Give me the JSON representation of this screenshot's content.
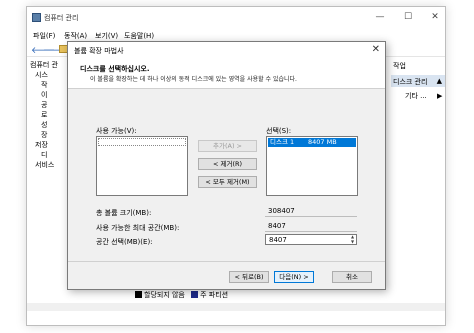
{
  "window": {
    "title": "컴퓨터 관리",
    "controls": {
      "minimize": "—",
      "maximize": "☐",
      "close": "✕"
    }
  },
  "menu": [
    "파일(F)",
    "동작(A)",
    "보기(V)",
    "도움말(H)"
  ],
  "toolbar": {
    "back_icon": "🡐",
    "forward_icon": "🡒"
  },
  "tree": {
    "root": "컴퓨터 관",
    "items": [
      "시스",
      "작",
      "이",
      "공",
      "로",
      "성",
      "장",
      "저장",
      "디",
      "서비스"
    ]
  },
  "actions": {
    "header": "작업",
    "selected": "디스크 관리",
    "selected_arrow": "▲",
    "other": "기타 ...",
    "other_arrow": "▶"
  },
  "legend": {
    "unallocated": "할당되지 않음",
    "primary": "주 파티션"
  },
  "dialog": {
    "title": "볼륨 확장 마법사",
    "close": "✕",
    "heading": "디스크를 선택하십시오.",
    "subheading": "이 볼륨을 확장하는 데 하나 이상의 동적 디스크에 있는 영역을 사용할 수 있습니다.",
    "available_label": "사용 가능(V):",
    "selected_label": "선택(S):",
    "selected_items": [
      {
        "name": "디스크 1",
        "size": "8407 MB"
      }
    ],
    "add_button": "추가(A) >",
    "remove_button": "< 제거(R)",
    "remove_all_button": "< 모두 제거(M)",
    "total_size_label": "총 볼륨 크기(MB):",
    "total_size_value": "308407",
    "max_space_label": "사용 가능한 최대 공간(MB):",
    "max_space_value": "8407",
    "select_space_label": "공간 선택(MB)(E):",
    "select_space_value": "8407",
    "back_button": "< 뒤로(B)",
    "next_button": "다음(N) >",
    "cancel_button": "취소"
  }
}
